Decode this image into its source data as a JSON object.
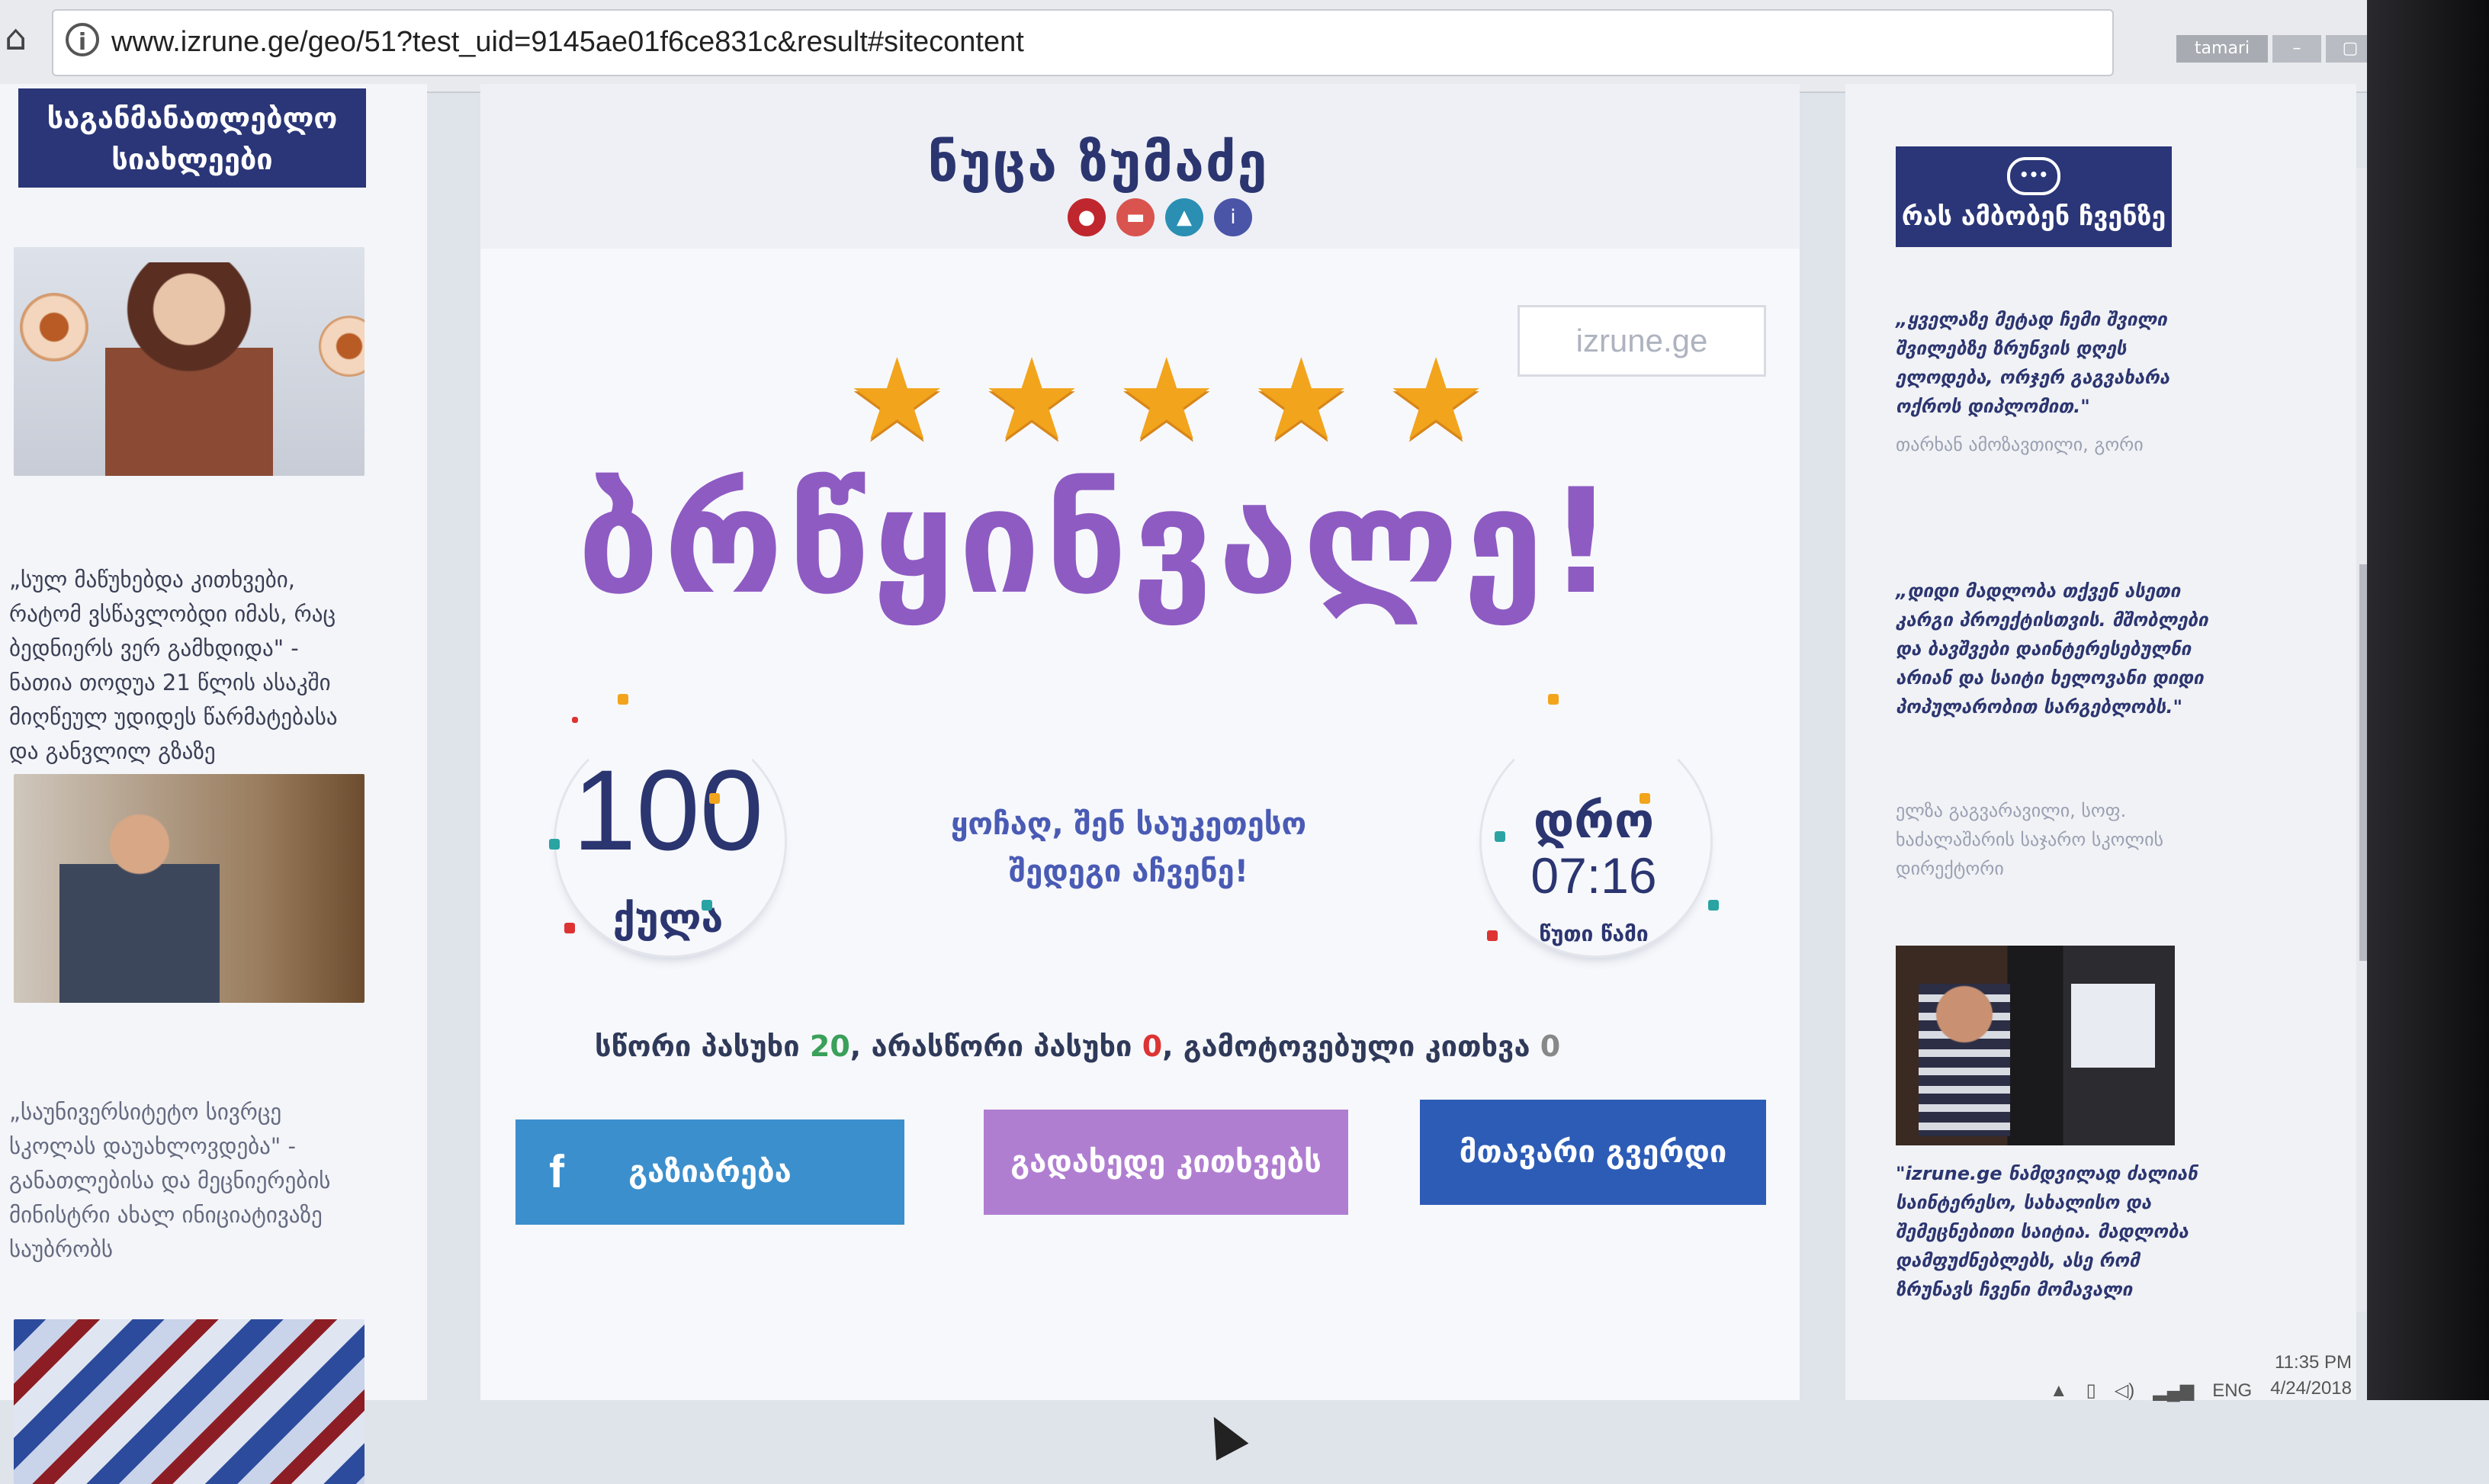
{
  "browser": {
    "url": "www.izrune.ge/geo/51?test_uid=9145ae01f6ce831c&result#sitecontent",
    "user_label": "tamari",
    "minimize": "–",
    "maximize": "▢",
    "close": "✕"
  },
  "left_sidebar": {
    "banner": "საგანმანათლებლო სიახლეები",
    "news": [
      {
        "text": "„სულ მაწუხებდა კითხვები, რატომ ვსწავლობდი იმას, რაც ბედნიერს ვერ გამხდიდა\" - ნათია თოდუა 21 წლის ასაკში მიღწეულ უდიდეს წარმატებასა და განვლილ გზაზე"
      },
      {
        "text": "„საუნივერსიტეტო სივრცე სკოლას დაუახლოვდება\" - განათლებისა და მეცნიერების მინისტრი ახალ ინიციატივაზე საუბრობს"
      }
    ]
  },
  "result": {
    "user_name": "ნუცა ზუმაძე",
    "watermark": "izrune.ge",
    "stars": 5,
    "grade_word": "ბრწყინვალე!",
    "points_value": "100",
    "points_label": "ქულა",
    "message": "ყოჩაღ, შენ საუკეთესო შედეგი აჩვენე!",
    "time_label": "დრო",
    "time_value": "07:16",
    "time_unit": "წუთი წამი",
    "summary": {
      "correct_label": "სწორი პასუხი",
      "correct_value": "20",
      "wrong_label": ", არასწორი პასუხი",
      "wrong_value": "0",
      "skipped_label": ", გამოტოვებული კითხვა",
      "skipped_value": "0"
    },
    "buttons": {
      "share": "გაზიარება",
      "share_icon": "f",
      "review": "გადახედე კითხვებს",
      "home": "მთავარი გვერდი"
    }
  },
  "right_sidebar": {
    "banner": "რას ამბობენ ჩვენზე",
    "testimonials": [
      {
        "quote": "„ყველაზე მეტად ჩემი შვილი შვილებზე ზრუნვის დღეს ელოდება, ორჯერ გაგვახარა ოქროს დიპლომით.\"",
        "author": "თარხან ამოზავთილი, გორი"
      },
      {
        "quote": "„დიდი მადლობა თქვენ ასეთი კარგი პროექტისთვის. მშობლები და ბავშვები დაინტერესებულნი არიან და საიტი ხელოვანი დიდი პოპულარობით სარგებლობს.\"",
        "author": "ელზა გაგვარავილი, სოფ. ხაძალაშარის საჯარო სკოლის დირექტორი"
      },
      {
        "quote": "\"izrune.ge ნამდვილად ძალიან საინტერესო, სახალისო და შემეცნებითი საიტია. მადლობა დამფუძნებლებს, ასე რომ ზრუნავს ჩვენი მომავალი"
      }
    ]
  },
  "taskbar": {
    "lang": "ENG",
    "time": "11:35 PM",
    "date": "4/24/2018"
  },
  "colors": {
    "brand_navy": "#2a3677",
    "grade_purple": "#8e5bc3",
    "star_orange": "#f2a41c",
    "share_blue": "#3b8fcd",
    "review_purple": "#b07ed1",
    "home_blue": "#2d5cb6"
  }
}
